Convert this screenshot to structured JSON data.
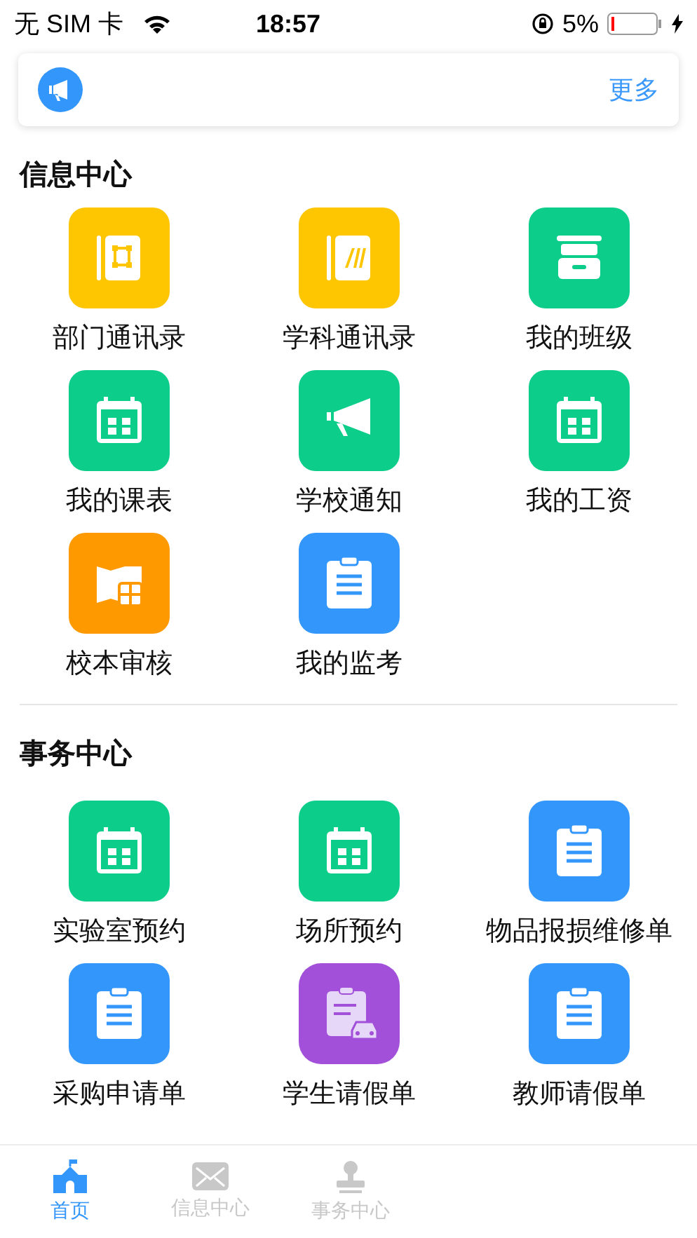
{
  "status_bar": {
    "carrier": "无 SIM 卡",
    "time": "18:57",
    "battery": "5%"
  },
  "notice": {
    "more": "更多"
  },
  "sections": [
    {
      "title": "信息中心",
      "items": [
        {
          "label": "部门通讯录",
          "kind": "contacts",
          "color": "#fec600"
        },
        {
          "label": "学科通讯录",
          "kind": "book",
          "color": "#fec600"
        },
        {
          "label": "我的班级",
          "kind": "cabinet",
          "color": "#0ccd8a"
        },
        {
          "label": "我的课表",
          "kind": "calendar",
          "color": "#0ccd8a"
        },
        {
          "label": "学校通知",
          "kind": "megaphone",
          "color": "#0ccd8a"
        },
        {
          "label": "我的工资",
          "kind": "calendar",
          "color": "#0ccd8a"
        },
        {
          "label": "校本审核",
          "kind": "map",
          "color": "#fe9a00"
        },
        {
          "label": "我的监考",
          "kind": "clipboard",
          "color": "#3396fb"
        }
      ]
    },
    {
      "title": "事务中心",
      "items": [
        {
          "label": "实验室预约",
          "kind": "calendar",
          "color": "#0ccd8a"
        },
        {
          "label": "场所预约",
          "kind": "calendar",
          "color": "#0ccd8a"
        },
        {
          "label": "物品报损维修单",
          "kind": "clipboard",
          "color": "#3396fb"
        },
        {
          "label": "采购申请单",
          "kind": "clipboard",
          "color": "#3396fb"
        },
        {
          "label": "学生请假单",
          "kind": "clipboard-car",
          "color": "#a24fd9"
        },
        {
          "label": "教师请假单",
          "kind": "clipboard",
          "color": "#3396fb"
        }
      ]
    }
  ],
  "tabs": [
    {
      "label": "首页",
      "kind": "school",
      "selected": true
    },
    {
      "label": "信息中心",
      "kind": "mail",
      "selected": false
    },
    {
      "label": "事务中心",
      "kind": "stamp",
      "selected": false
    }
  ]
}
